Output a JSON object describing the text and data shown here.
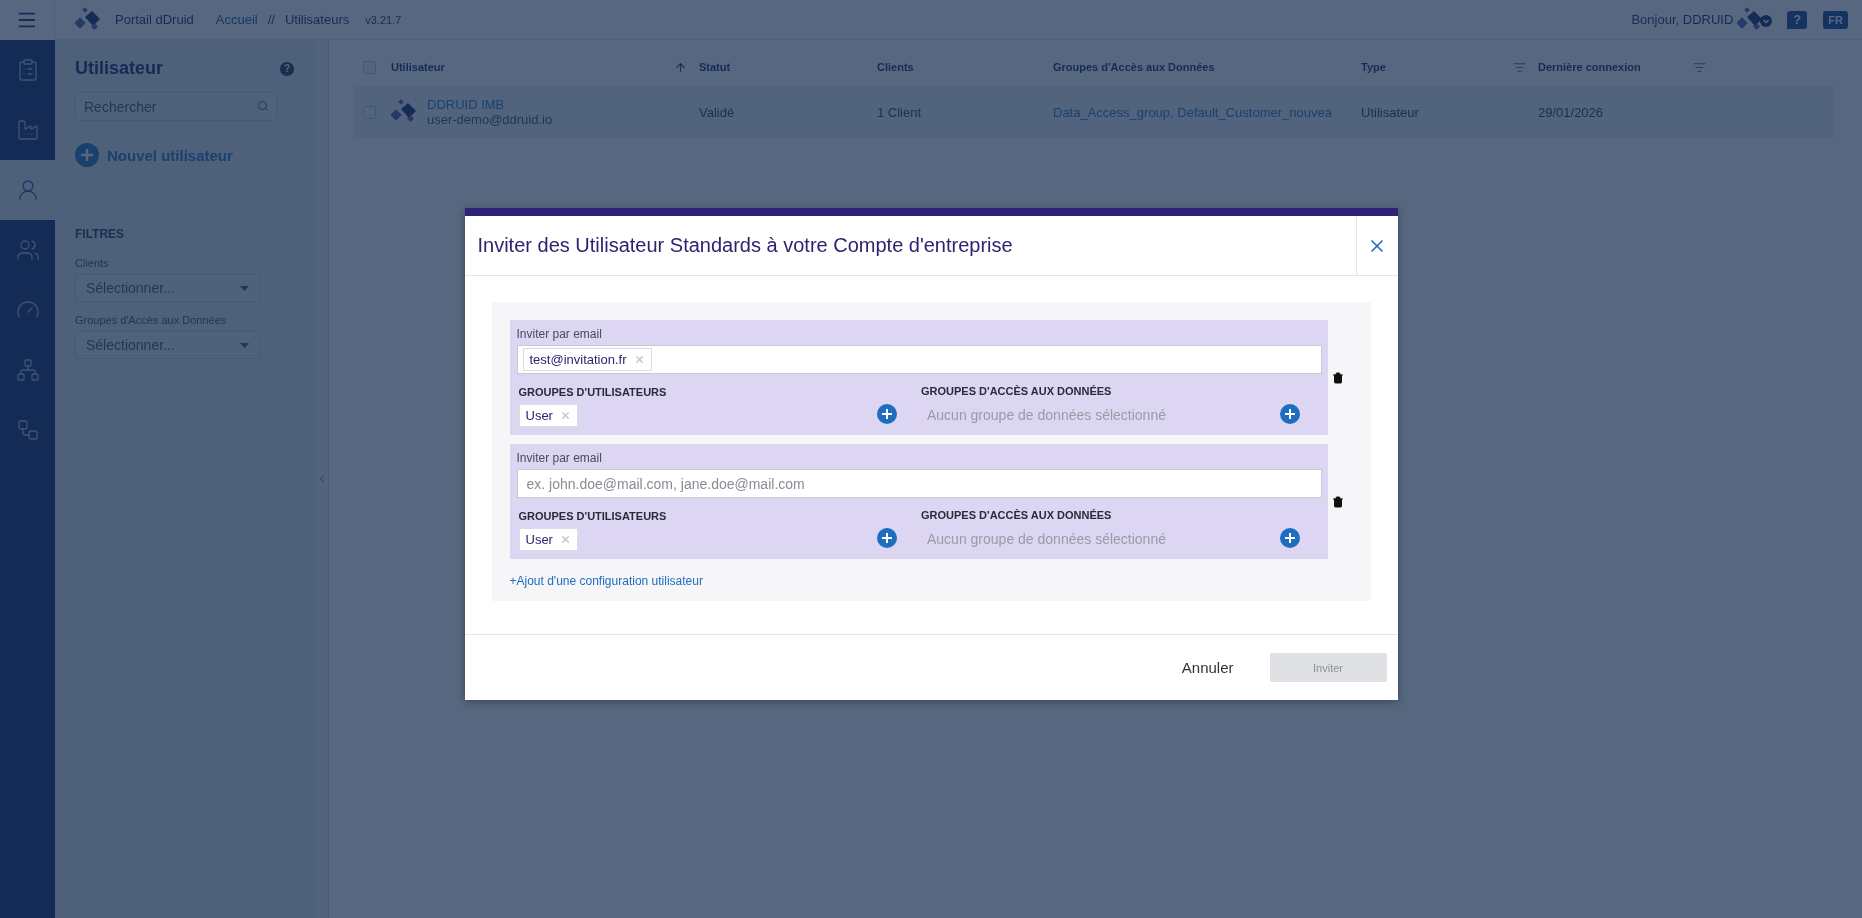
{
  "topbar": {
    "app_name": "Portail dDruid",
    "breadcrumb": [
      "Accueil",
      "Utilisateurs"
    ],
    "separator": "//",
    "version": "v3.21.7",
    "greeting": "Bonjour, DDRUID",
    "help": "?",
    "language": "FR"
  },
  "nav_items": [
    {
      "selected": false
    },
    {
      "selected": false
    },
    {
      "selected": true
    },
    {
      "selected": false
    },
    {
      "selected": false
    },
    {
      "selected": false
    },
    {
      "selected": false
    }
  ],
  "sidebar": {
    "title": "Utilisateur",
    "help": "?",
    "search": {
      "placeholder": "Rechercher"
    },
    "new_user": "Nouvel utilisateur",
    "filters_title": "FILTRES",
    "filters": [
      {
        "label": "Clients",
        "placeholder": "Sélectionner..."
      },
      {
        "label": "Groupes d'Accès aux Données",
        "placeholder": "Sélectionner..."
      }
    ]
  },
  "table": {
    "columns": [
      {
        "label": "Utilisateur",
        "kind": "sort"
      },
      {
        "label": "Statut",
        "kind": "plain"
      },
      {
        "label": "Clients",
        "kind": "plain"
      },
      {
        "label": "Groupes d'Accès aux Données",
        "kind": "plain"
      },
      {
        "label": "Type",
        "kind": "filter"
      },
      {
        "label": "Dernière connexion",
        "kind": "filter"
      }
    ],
    "all_checked": false,
    "rows": [
      {
        "name": "DDRUID IMB",
        "email": "user-demo@ddruid.io",
        "status": "Validé",
        "clients": "1 Client",
        "groups": "Data_Access_group, Default_Customer_nouvea",
        "type": "Utilisateur",
        "last_login": "29/01/2026",
        "checked": false
      }
    ]
  },
  "modal": {
    "title": "Inviter des Utilisateur Standards à votre Compte d'entreprise",
    "configs": [
      {
        "email_label": "Inviter par email",
        "emails": [
          "test@invitation.fr"
        ],
        "user_groups_label": "GROUPES D'UTILISATEURS",
        "user_groups": [
          "User"
        ],
        "data_groups_label": "GROUPES D'ACCÈS AUX DONNÉES",
        "data_groups_empty": "Aucun groupe de données sélectionné"
      },
      {
        "email_label": "Inviter par email",
        "email_placeholder": "ex. john.doe@mail.com, jane.doe@mail.com",
        "user_groups_label": "GROUPES D'UTILISATEURS",
        "user_groups": [
          "User"
        ],
        "data_groups_label": "GROUPES D'ACCÈS AUX DONNÉES",
        "data_groups_empty": "Aucun groupe de données sélectionné"
      }
    ],
    "add_link": "+Ajout d'une configuration utilisateur",
    "cancel": "Annuler",
    "invite": {
      "label": "Inviter",
      "disabled": true
    }
  }
}
